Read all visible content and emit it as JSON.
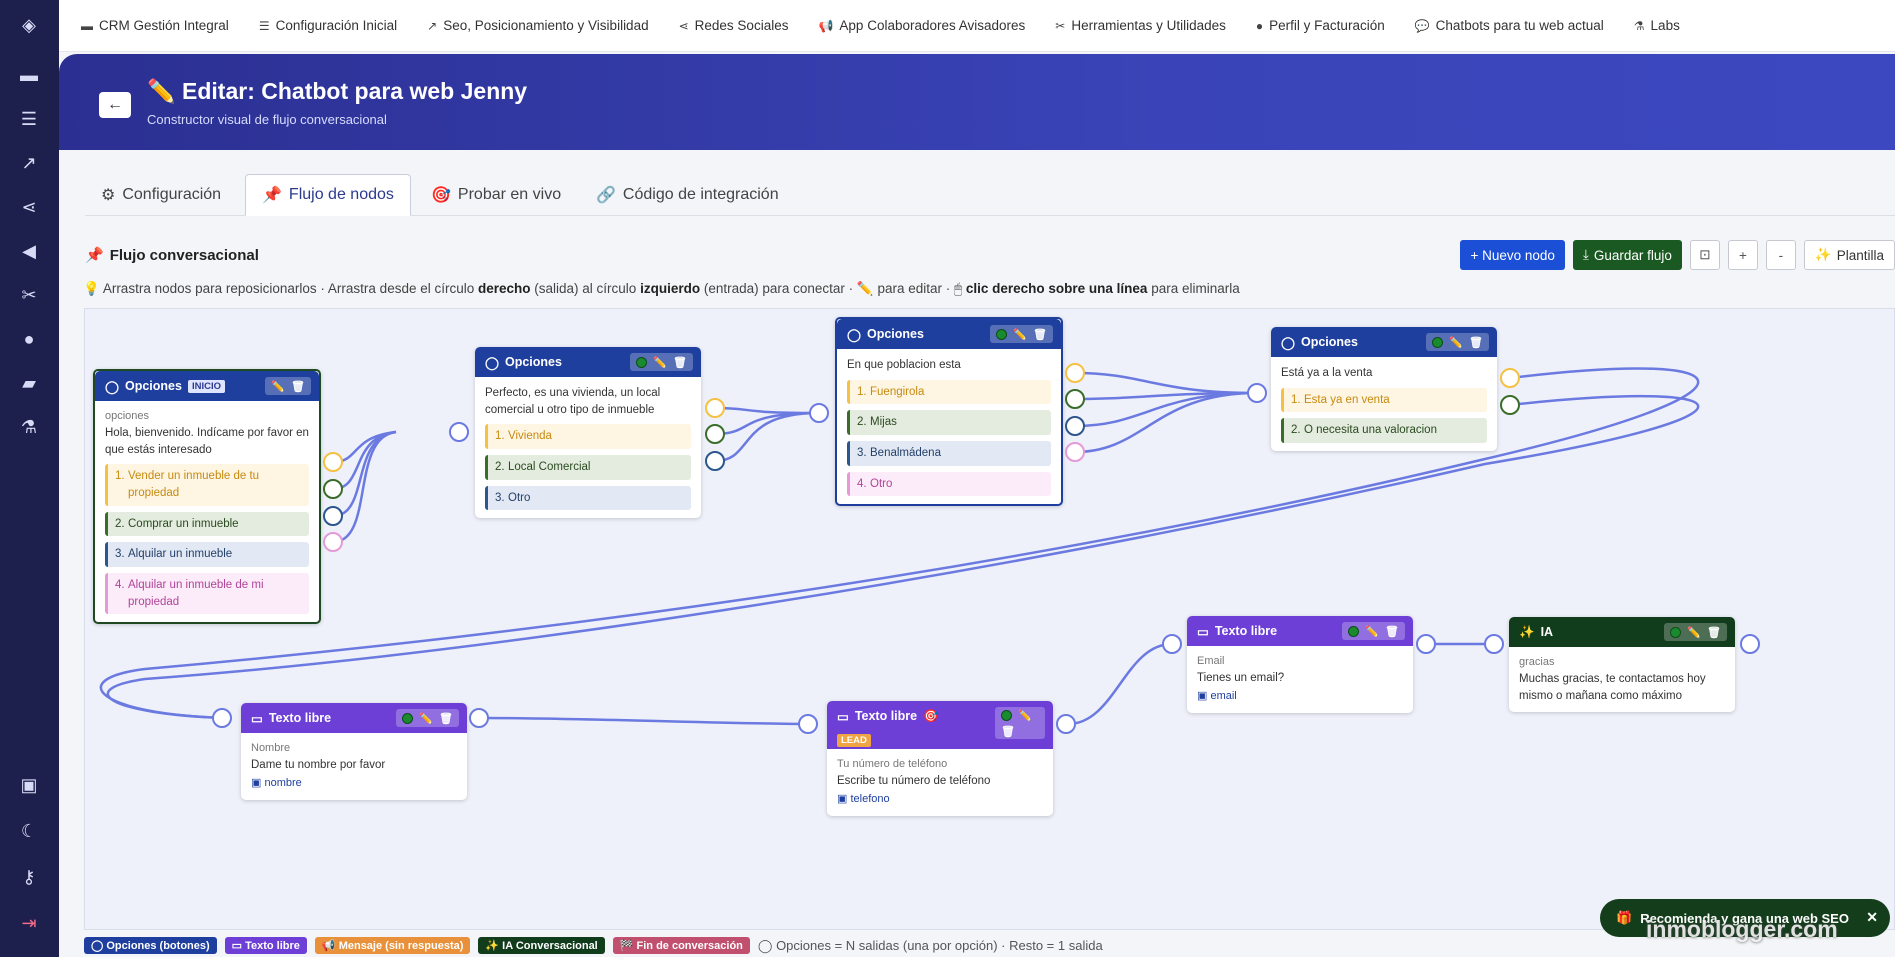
{
  "nav": {
    "items": [
      {
        "icon": "▬",
        "label": "CRM Gestión Integral"
      },
      {
        "icon": "☰",
        "label": "Configuración Inicial"
      },
      {
        "icon": "↗",
        "label": "Seo, Posicionamiento y Visibilidad"
      },
      {
        "icon": "⋖",
        "label": "Redes Sociales"
      },
      {
        "icon": "📢",
        "label": "App Colaboradores Avisadores"
      },
      {
        "icon": "✂",
        "label": "Herramientas y Utilidades"
      },
      {
        "icon": "●",
        "label": "Perfil y Facturación"
      },
      {
        "icon": "💬",
        "label": "Chatbots para tu web actual"
      },
      {
        "icon": "⚗",
        "label": "Labs"
      }
    ]
  },
  "header": {
    "back_icon": "←",
    "title_icon": "✏️",
    "title": "Editar: Chatbot para web Jenny",
    "subtitle": "Constructor visual de flujo conversacional"
  },
  "tabs": [
    {
      "icon": "⚙",
      "label": "Configuración"
    },
    {
      "icon": "📌",
      "label": "Flujo de nodos"
    },
    {
      "icon": "🎯",
      "label": "Probar en vivo"
    },
    {
      "icon": "🔗",
      "label": "Código de integración"
    }
  ],
  "flow": {
    "title_icon": "📌",
    "title": "Flujo conversacional",
    "hint": {
      "p1": "💡 Arrastra nodos para reposicionarlos · Arrastra desde el círculo ",
      "b1": "derecho",
      "p2": " (salida) al círculo ",
      "b2": "izquierdo",
      "p3": " (entrada) para conectar · ✏️ para editar · 🖱 ",
      "b3": "clic derecho sobre una línea",
      "p4": " para eliminarla"
    }
  },
  "toolbar": {
    "new_node": "+ Nuevo nodo",
    "save_flow": "Guardar flujo",
    "fit": "⊡",
    "zoom_in": "+",
    "zoom_out": "-",
    "template": "Plantilla"
  },
  "nodes": {
    "n1": {
      "type": "Opciones",
      "badge": "INICIO",
      "label": "opciones",
      "text": "Hola, bienvenido. Indícame por favor en que estás interesado",
      "options": [
        "Vender un inmueble de tu propiedad",
        "Comprar un inmueble",
        "Alquilar un inmueble",
        "Alquilar un inmueble de mi propiedad"
      ]
    },
    "n2": {
      "type": "Opciones",
      "text": "Perfecto, es una vivienda, un local comercial u otro tipo de inmueble",
      "options": [
        "Vivienda",
        "Local Comercial",
        "Otro"
      ]
    },
    "n3": {
      "type": "Opciones",
      "text": "En que poblacion esta",
      "options": [
        "Fuengirola",
        "Mijas",
        "Benalmádena",
        "Otro"
      ]
    },
    "n4": {
      "type": "Opciones",
      "text": "Está ya a la venta",
      "options": [
        "Esta ya en venta",
        "O necesita una valoracion"
      ]
    },
    "n5": {
      "type": "Texto libre",
      "label": "Nombre",
      "text": "Dame tu nombre por favor",
      "var": "nombre"
    },
    "n6": {
      "type": "Texto libre",
      "badge": "LEAD",
      "label": "Tu número de teléfono",
      "text": "Escribe tu número de teléfono",
      "var": "telefono"
    },
    "n7": {
      "type": "Texto libre",
      "label": "Email",
      "text": "Tienes un email?",
      "var": "email"
    },
    "n8": {
      "type": "IA",
      "label": "gracias",
      "text": "Muchas gracias, te contactamos hoy mismo o mañana como máximo"
    }
  },
  "legend": {
    "items": [
      {
        "label": "Opciones (botones)",
        "color": "#1f3f9e"
      },
      {
        "label": "Texto libre",
        "color": "#6d3fd6"
      },
      {
        "label": "Mensaje (sin respuesta)",
        "color": "#e8913a"
      },
      {
        "label": "IA Conversacional",
        "color": "#123d1c"
      },
      {
        "label": "Fin de conversación",
        "color": "#c0506d"
      }
    ],
    "note": "Opciones = N salidas (una por opción) · Resto = 1 salida"
  },
  "toast": {
    "text": "Recomienda y gana una web SEO",
    "close": "✕"
  },
  "watermark": "inmoblogger.com",
  "colors": {
    "rail": "#1d1f4c",
    "banner": "#3a44b8",
    "primary": "#1a4fd6",
    "success": "#1a5a22",
    "wire": "#6b7ae0"
  }
}
